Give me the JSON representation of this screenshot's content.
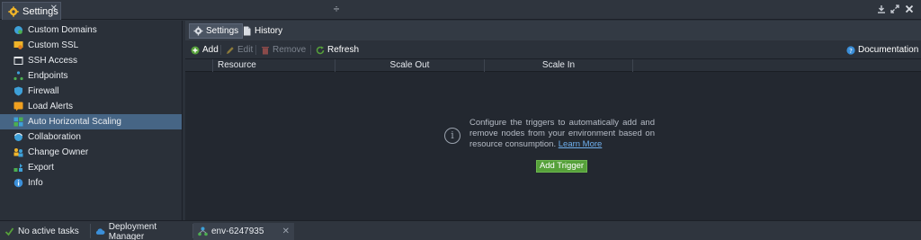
{
  "window": {
    "tab_label": "Settings",
    "close_glyph": "✕",
    "drag_glyph": "÷",
    "controls": [
      "download-icon",
      "expand-icon",
      "close-icon"
    ]
  },
  "sidebar": {
    "items": [
      {
        "label": "Custom Domains",
        "icon": "globe-icon"
      },
      {
        "label": "Custom SSL",
        "icon": "certificate-icon"
      },
      {
        "label": "SSH Access",
        "icon": "terminal-icon"
      },
      {
        "label": "Endpoints",
        "icon": "endpoints-icon"
      },
      {
        "label": "Firewall",
        "icon": "shield-icon"
      },
      {
        "label": "Load Alerts",
        "icon": "alert-icon"
      },
      {
        "label": "Auto Horizontal Scaling",
        "icon": "scaling-icon",
        "active": true
      },
      {
        "label": "Collaboration",
        "icon": "collaboration-icon"
      },
      {
        "label": "Change Owner",
        "icon": "change-owner-icon"
      },
      {
        "label": "Export",
        "icon": "export-icon"
      },
      {
        "label": "Info",
        "icon": "info-icon"
      }
    ]
  },
  "main": {
    "tabs": [
      {
        "label": "Settings",
        "icon": "gear-icon",
        "active": true
      },
      {
        "label": "History",
        "icon": "document-icon"
      }
    ],
    "toolbar": {
      "add": "Add",
      "edit": "Edit",
      "remove": "Remove",
      "refresh": "Refresh",
      "documentation": "Documentation"
    },
    "columns": [
      "Resource",
      "Scale Out",
      "Scale In"
    ],
    "empty": {
      "message": "Configure the triggers to automatically add and remove nodes from your environment based on resource consumption.",
      "link": "Learn More",
      "button": "Add Trigger"
    }
  },
  "bottom": {
    "tasks": [
      {
        "label": "No active tasks",
        "icon": "check-icon"
      },
      {
        "label": "Deployment Manager",
        "icon": "cloud-icon"
      },
      {
        "label": "env-6247935",
        "icon": "env-icon",
        "active": true
      }
    ],
    "close_glyph": "✕"
  },
  "colors": {
    "accent_active": "#466585",
    "add_green": "#56a13a",
    "link_blue": "#6fb0ee",
    "help_blue": "#3b8fd9"
  }
}
